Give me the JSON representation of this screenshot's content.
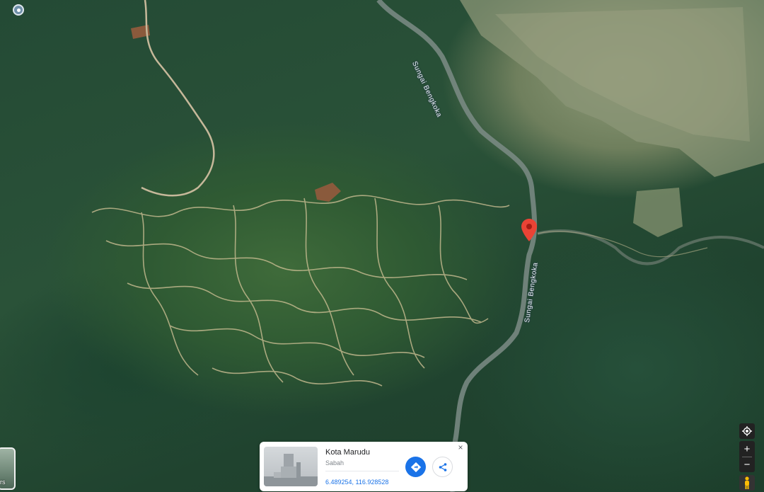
{
  "map": {
    "view": "satellite",
    "river_labels": [
      "Sungai Bengkoka",
      "Sungai Bengkoka"
    ]
  },
  "place_card": {
    "title": "Kota Marudu",
    "subtitle": "Sabah",
    "coordinates": "6.489254, 116.928528",
    "close_glyph": "×"
  },
  "layers": {
    "label": "rs"
  },
  "controls": {
    "zoom_in": "+",
    "zoom_out": "−"
  },
  "icons": {
    "pin": "location-pin-icon",
    "directions": "directions-icon",
    "share": "share-icon",
    "locate": "my-location-icon",
    "pegman": "pegman-icon"
  },
  "colors": {
    "pin": "#ea4335",
    "accent": "#1a73e8",
    "card_bg": "#ffffff",
    "control_bg": "#222222"
  }
}
